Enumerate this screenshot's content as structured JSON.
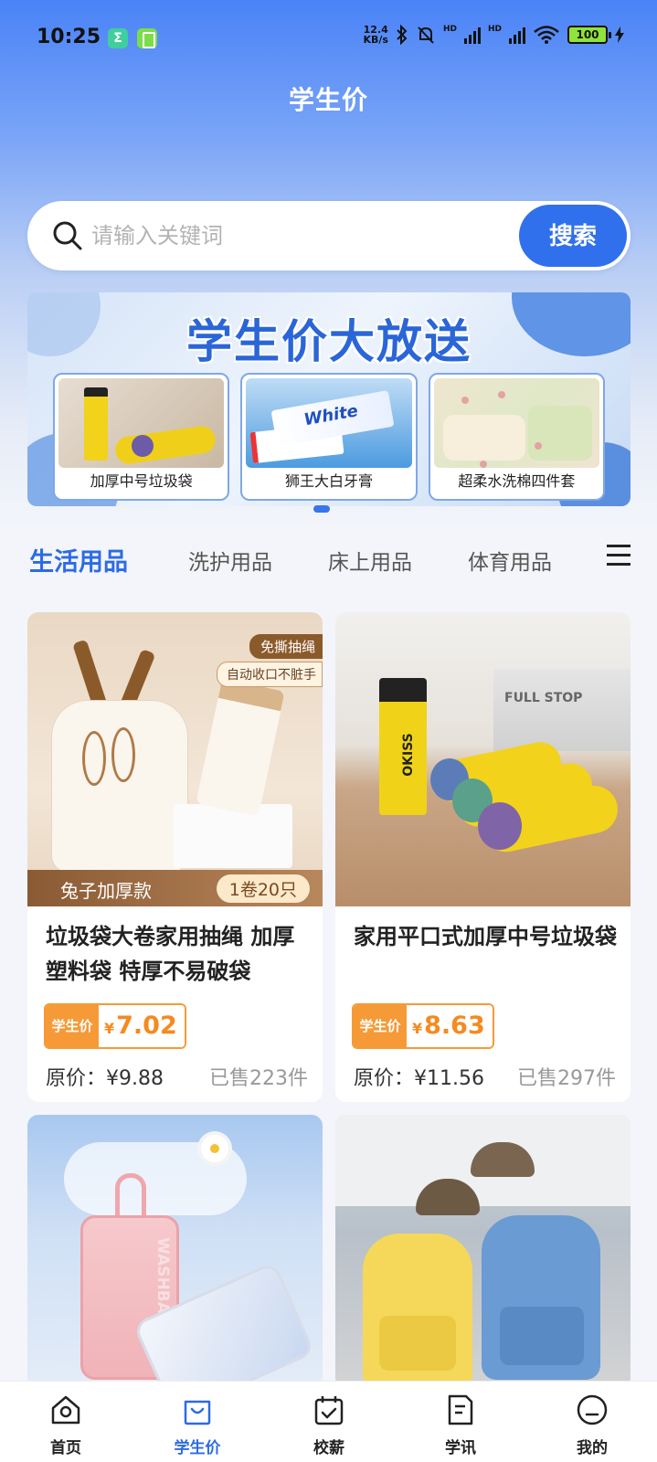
{
  "status_bar": {
    "time": "10:25",
    "speed_top": "12.4",
    "speed_bottom": "KB/s",
    "hd1": "HD",
    "hd2": "HD",
    "battery": "100",
    "app1_letter": "Σ"
  },
  "header": {
    "title": "学生价"
  },
  "search": {
    "placeholder": "请输入关键词",
    "button_label": "搜索"
  },
  "banner": {
    "title": "学生价大放送",
    "items": [
      {
        "label": "加厚中号垃圾袋"
      },
      {
        "label": "狮王大白牙膏"
      },
      {
        "label": "超柔水洗棉四件套"
      }
    ]
  },
  "categories": {
    "tabs": [
      {
        "label": "生活用品",
        "active": true
      },
      {
        "label": "洗护用品",
        "active": false
      },
      {
        "label": "床上用品",
        "active": false
      },
      {
        "label": "体育用品",
        "active": false
      }
    ]
  },
  "products": [
    {
      "title": "垃圾袋大卷家用抽绳 加厚塑料袋 特厚不易破袋",
      "price_label": "学生价",
      "currency": "¥",
      "price": "7.02",
      "original_price": "原价：¥9.88",
      "sold": "已售223件",
      "img_tag1": "免撕抽绳",
      "img_tag2": "自动收口不脏手",
      "img_bar_left": "兔子加厚款",
      "img_bar_right": "1卷20只"
    },
    {
      "title": "家用平口式加厚中号垃圾袋",
      "price_label": "学生价",
      "currency": "¥",
      "price": "8.63",
      "original_price": "原价：¥11.56",
      "sold": "已售297件"
    },
    {
      "title": "",
      "price_label": "",
      "currency": "",
      "price": "",
      "original_price": "",
      "sold": ""
    },
    {
      "title": "",
      "price_label": "",
      "currency": "",
      "price": "",
      "original_price": "",
      "sold": ""
    }
  ],
  "bottom_nav": {
    "items": [
      {
        "label": "首页",
        "icon": "home-icon",
        "active": false
      },
      {
        "label": "学生价",
        "icon": "shopping-bag-icon",
        "active": true
      },
      {
        "label": "校薪",
        "icon": "calendar-check-icon",
        "active": false
      },
      {
        "label": "学讯",
        "icon": "document-icon",
        "active": false
      },
      {
        "label": "我的",
        "icon": "profile-icon",
        "active": false
      }
    ]
  },
  "colors": {
    "primary": "#2c6be4",
    "price_orange": "#f59a36",
    "header_gradient_top": "#4a83f7"
  }
}
